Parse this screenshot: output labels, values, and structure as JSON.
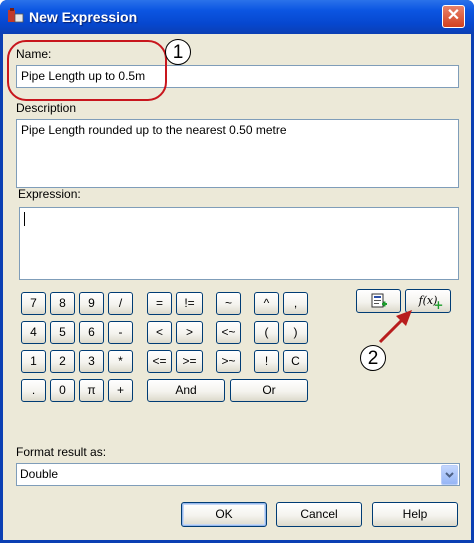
{
  "window": {
    "title": "New Expression",
    "close_glyph": "✕",
    "icon": "app-icon"
  },
  "name_field": {
    "label": "Name:",
    "value": "Pipe Length up to 0.5m"
  },
  "description_field": {
    "label": "Description",
    "value": "Pipe Length rounded up to the nearest 0.50 metre"
  },
  "expression_field": {
    "label": "Expression:",
    "value": ""
  },
  "keypad": {
    "row1": [
      "7",
      "8",
      "9",
      "/",
      "=",
      "!=",
      "~",
      "^",
      ","
    ],
    "row2": [
      "4",
      "5",
      "6",
      "-",
      "<",
      ">",
      "<~",
      "(",
      ")"
    ],
    "row3": [
      "1",
      "2",
      "3",
      "*",
      "<=",
      ">=",
      ">~",
      "!",
      "C"
    ],
    "row4": [
      ".",
      "0",
      "π",
      "+",
      "And",
      "Or"
    ]
  },
  "tools": {
    "insert_property_icon": "insert-property-icon",
    "insert_function_icon": "insert-function-icon",
    "function_glyph": "f(x)"
  },
  "callouts": [
    "1",
    "2"
  ],
  "format": {
    "label": "Format result as:",
    "value": "Double"
  },
  "dialog_buttons": {
    "ok": "OK",
    "cancel": "Cancel",
    "help": "Help"
  },
  "colors": {
    "title_bar": "#0c56e2",
    "dialog_bg": "#ece9d8",
    "callout_red": "#c8161d",
    "arrow_red": "#b81d1d"
  }
}
